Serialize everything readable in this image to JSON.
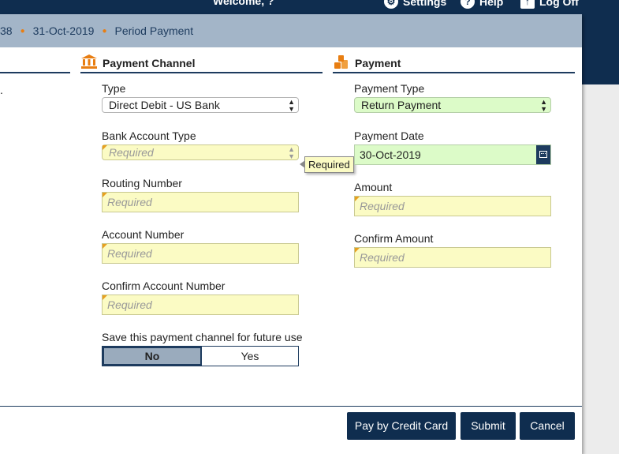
{
  "header": {
    "welcome": "Welcome, ?",
    "nav": [
      {
        "label": "Settings",
        "icon": "gear-icon"
      },
      {
        "label": "Help",
        "icon": "help-icon"
      },
      {
        "label": "Log Off",
        "icon": "logoff-icon"
      }
    ]
  },
  "breadcrumb": {
    "items": [
      "38",
      "31-Oct-2019",
      "Period Payment"
    ]
  },
  "channel": {
    "title": "Payment Channel",
    "type_label": "Type",
    "type_value": "Direct Debit - US Bank",
    "bank_account_type_label": "Bank Account Type",
    "bank_account_type_placeholder": "Required",
    "routing_label": "Routing Number",
    "routing_placeholder": "Required",
    "account_label": "Account Number",
    "account_placeholder": "Required",
    "confirm_account_label": "Confirm Account Number",
    "confirm_account_placeholder": "Required",
    "save_label": "Save this payment channel for future use",
    "save_options": [
      "No",
      "Yes"
    ],
    "save_selected": "No"
  },
  "tooltip": {
    "text": "Required"
  },
  "payment": {
    "title": "Payment",
    "type_label": "Payment Type",
    "type_value": "Return Payment",
    "date_label": "Payment Date",
    "date_value": "30-Oct-2019",
    "amount_label": "Amount",
    "amount_placeholder": "Required",
    "confirm_amount_label": "Confirm Amount",
    "confirm_amount_placeholder": "Required"
  },
  "footer": {
    "credit_card_label": "Pay by Credit Card",
    "submit_label": "Submit",
    "cancel_label": "Cancel"
  },
  "colors": {
    "navy": "#0f2d4f",
    "breadcrumb_bg": "#a3b5c8",
    "required_bg": "#fbfbc4",
    "valid_bg": "#dcfbc8",
    "accent": "#e87e12"
  }
}
